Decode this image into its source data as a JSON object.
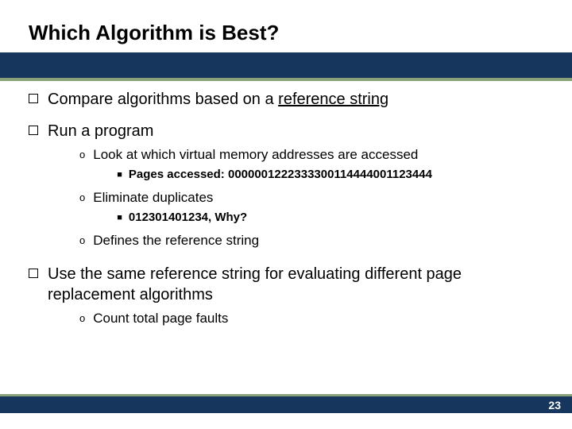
{
  "title": "Which Algorithm is Best?",
  "bullets": [
    {
      "text_pre": "Compare algorithms based on a ",
      "text_under": "reference string",
      "children": []
    },
    {
      "text": "Run a program",
      "children": [
        {
          "text": "Look at which virtual memory addresses are accessed",
          "children": [
            {
              "text": "Pages accessed: 0000001222333300114444001123444"
            }
          ]
        },
        {
          "text": "Eliminate duplicates",
          "children": [
            {
              "text": "012301401234, Why?"
            }
          ]
        },
        {
          "text": "Defines the reference string",
          "children": []
        }
      ]
    },
    {
      "text": "Use the same reference string for evaluating different page replacement algorithms",
      "children": [
        {
          "text": "Count total page faults",
          "children": []
        }
      ]
    }
  ],
  "pageNumber": "23"
}
